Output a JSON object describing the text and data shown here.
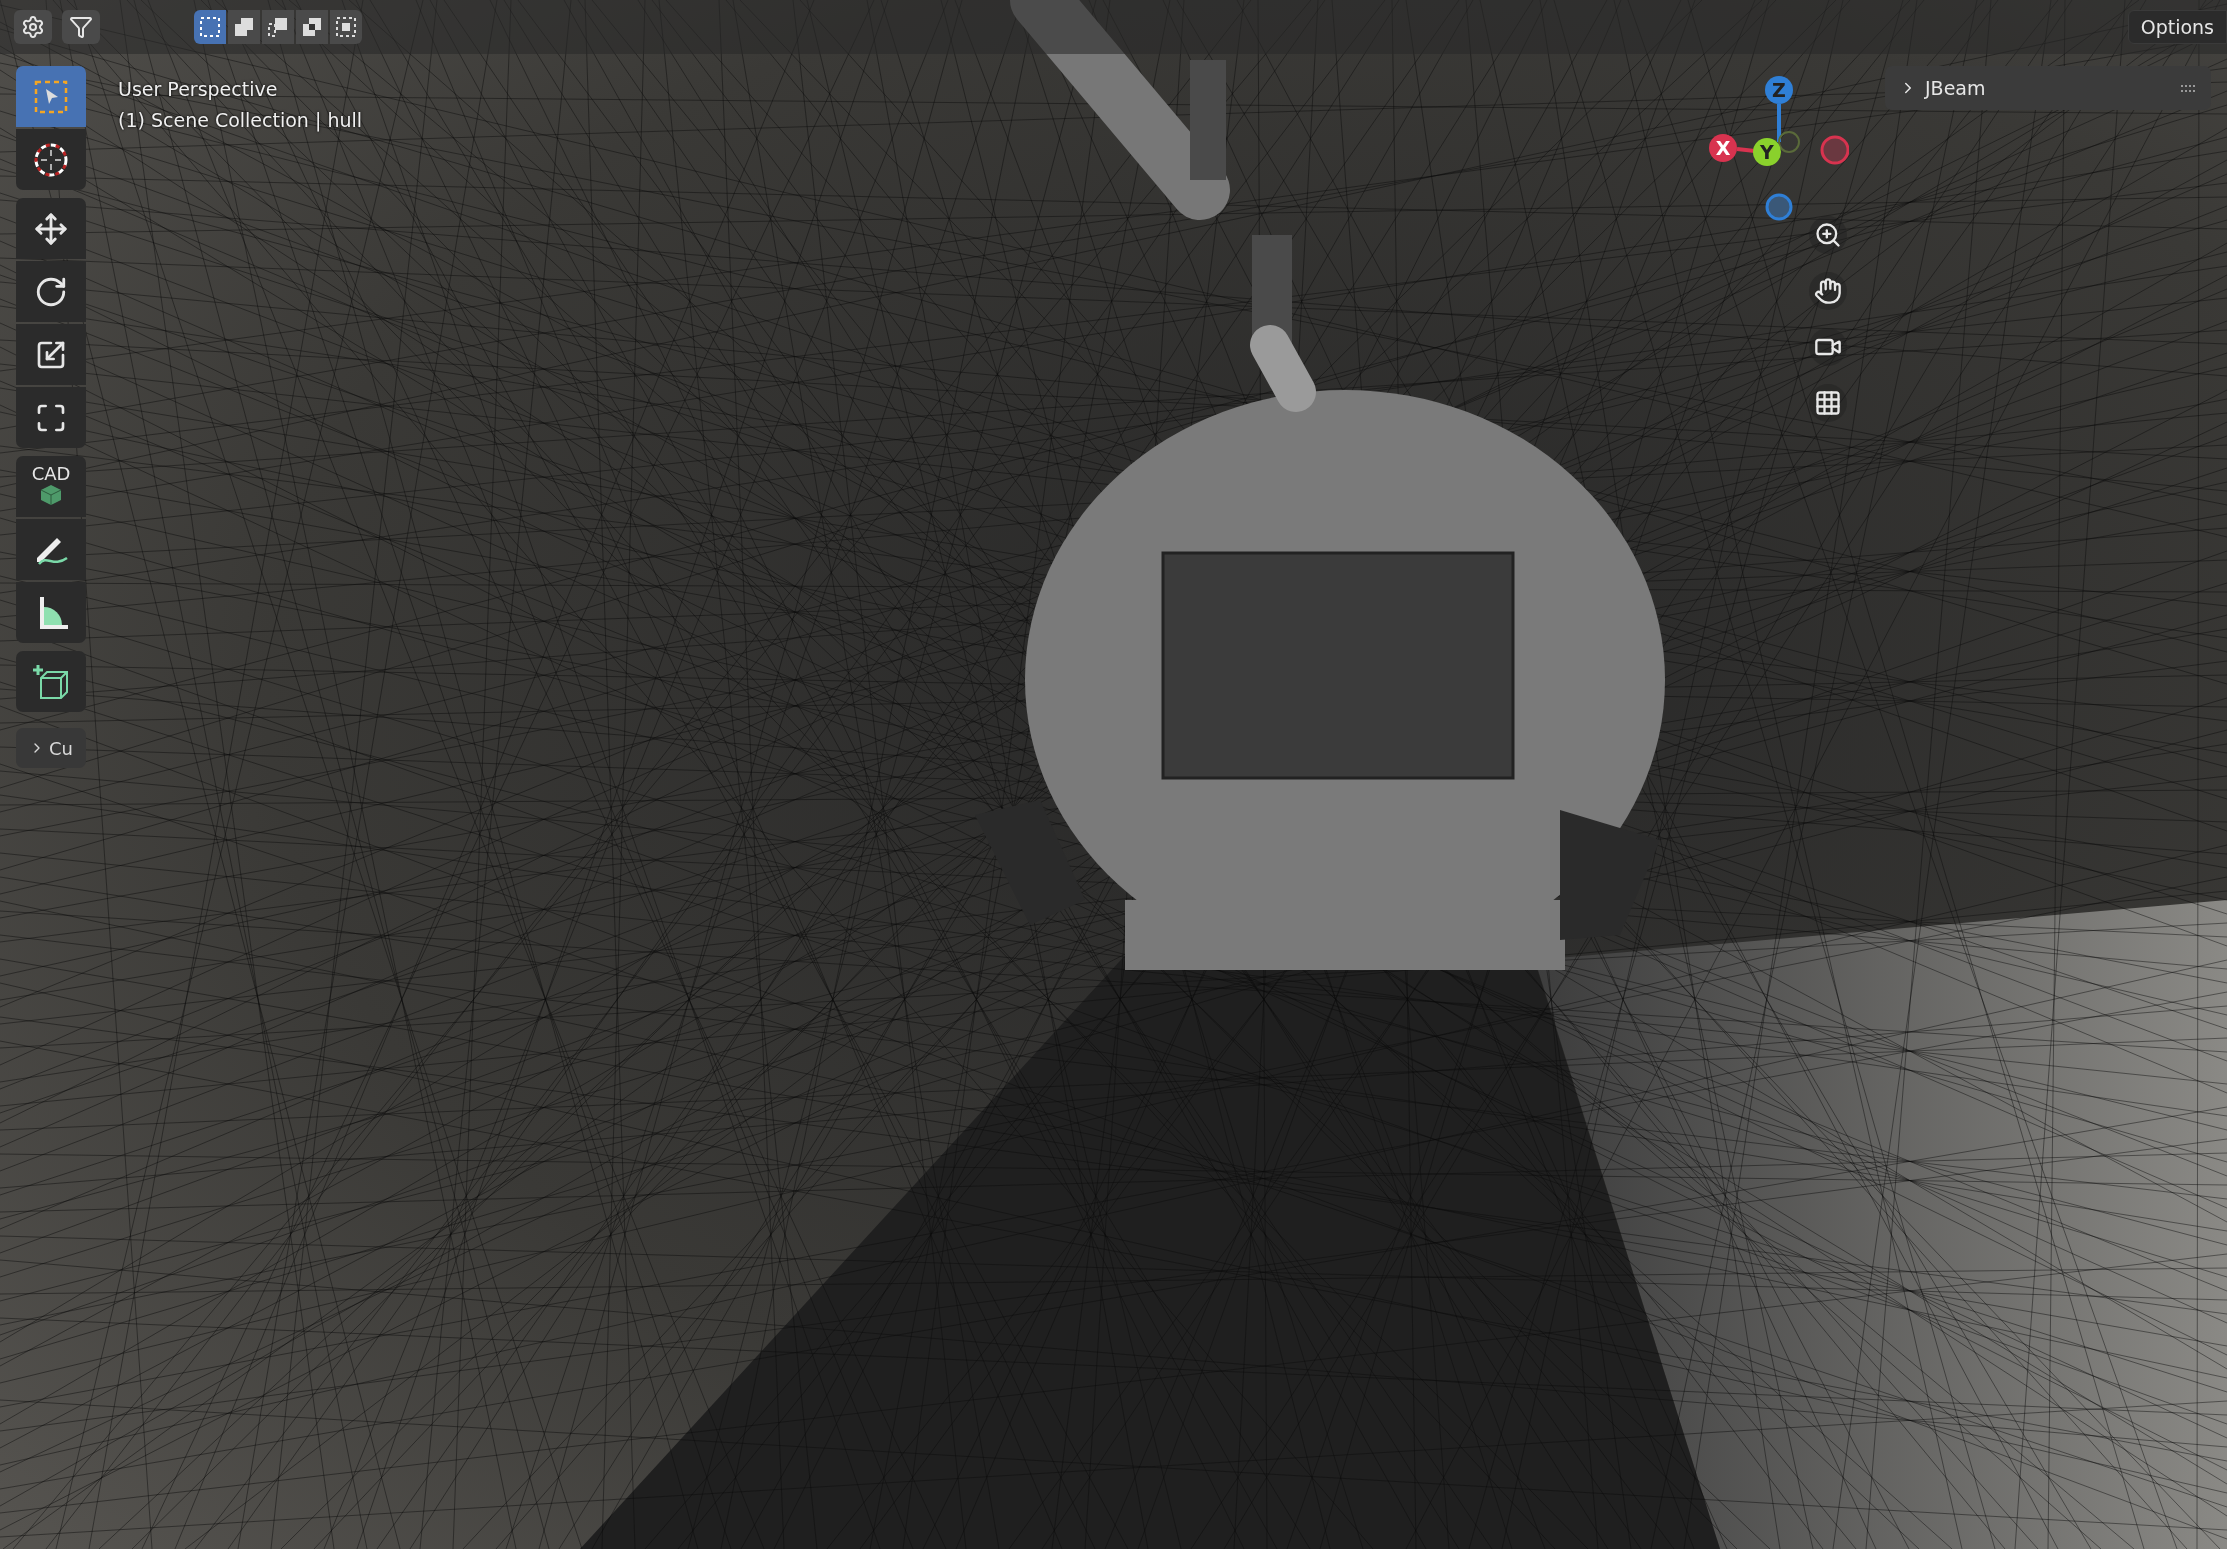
{
  "header": {
    "buttons": [
      {
        "kind": "settings"
      },
      {
        "kind": "filter"
      }
    ],
    "select_modes": [
      {
        "kind": "new",
        "selected": true
      },
      {
        "kind": "extend",
        "selected": false
      },
      {
        "kind": "subtract",
        "selected": false
      },
      {
        "kind": "invert",
        "selected": false
      },
      {
        "kind": "intersect",
        "selected": false
      }
    ],
    "options_button": "Options"
  },
  "toolbar": {
    "groups": [
      [
        {
          "kind": "select",
          "selected": true
        },
        {
          "kind": "cursor",
          "selected": false
        }
      ],
      [
        {
          "kind": "move",
          "selected": false
        },
        {
          "kind": "rotate",
          "selected": false
        },
        {
          "kind": "scale",
          "selected": false
        },
        {
          "kind": "transform",
          "selected": false
        }
      ],
      [
        {
          "kind": "cad",
          "label": "CAD",
          "selected": false
        },
        {
          "kind": "annotate",
          "selected": false
        },
        {
          "kind": "measure",
          "selected": false
        }
      ],
      [
        {
          "kind": "add",
          "selected": false
        }
      ]
    ],
    "collapsed_panel": {
      "label": "Cu",
      "expanded": false
    }
  },
  "viewport_info": [
    "User Perspective",
    "(1) Scene Collection | hull"
  ],
  "gizmo": {
    "axes": [
      {
        "label": "Z",
        "color": "#2f7fd6"
      },
      {
        "label": "X",
        "color": "#d8334f"
      },
      {
        "label": "Y",
        "color": "#8ad12c"
      }
    ]
  },
  "navigation": [
    {
      "kind": "zoom"
    },
    {
      "kind": "pan"
    },
    {
      "kind": "camera"
    },
    {
      "kind": "perspective"
    }
  ],
  "sidebar_panel": {
    "title": "JBeam",
    "expanded": false
  }
}
